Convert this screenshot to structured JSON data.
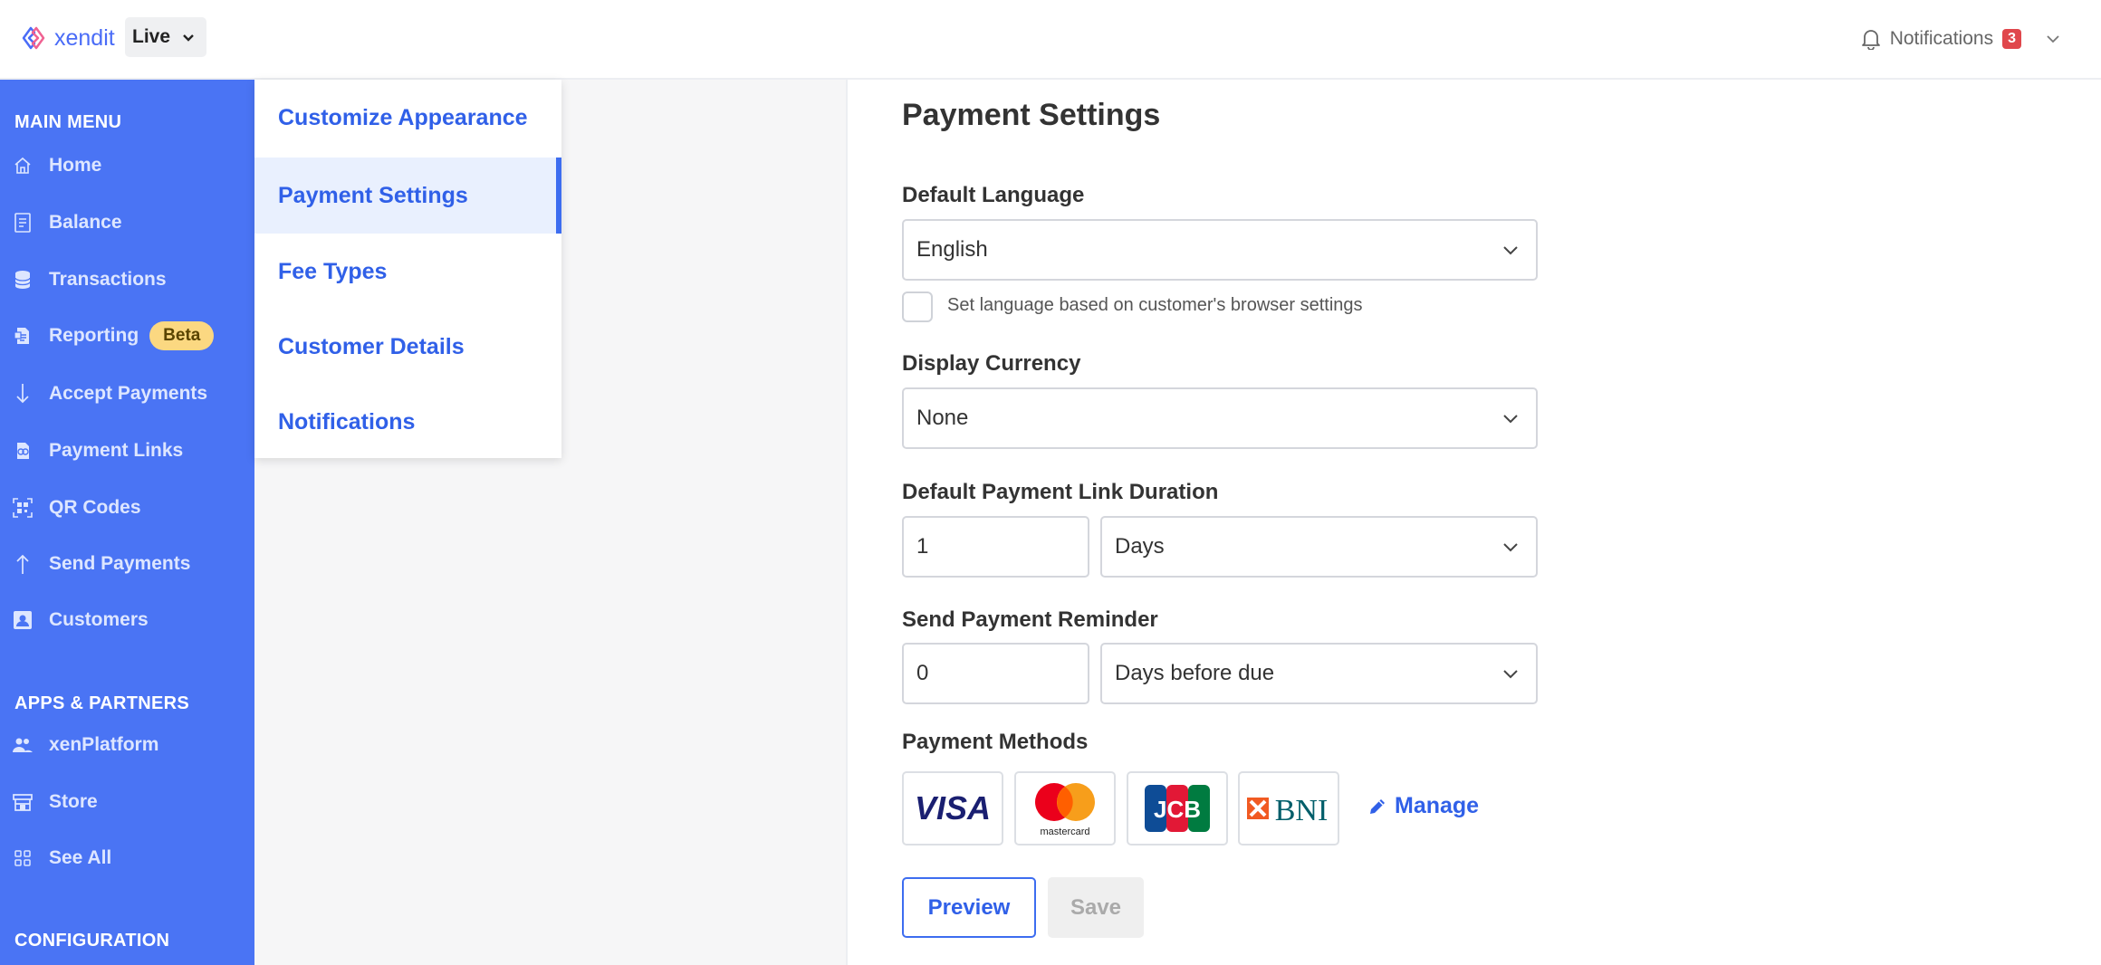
{
  "topbar": {
    "brand": "xendit",
    "environment": "Live",
    "notifications_label": "Notifications",
    "notifications_count": "3"
  },
  "sidebar": {
    "main_menu_title": "MAIN MENU",
    "main_items": [
      {
        "label": "Home",
        "icon": "home-icon"
      },
      {
        "label": "Balance",
        "icon": "document-icon"
      },
      {
        "label": "Transactions",
        "icon": "coins-icon"
      },
      {
        "label": "Reporting",
        "icon": "report-icon",
        "badge": "Beta"
      },
      {
        "label": "Accept Payments",
        "icon": "arrow-down-icon"
      },
      {
        "label": "Payment Links",
        "icon": "link-icon"
      },
      {
        "label": "QR Codes",
        "icon": "qr-code-icon"
      },
      {
        "label": "Send Payments",
        "icon": "arrow-up-icon"
      },
      {
        "label": "Customers",
        "icon": "user-card-icon"
      }
    ],
    "apps_title": "APPS & PARTNERS",
    "apps_items": [
      {
        "label": "xenPlatform",
        "icon": "users-icon"
      },
      {
        "label": "Store",
        "icon": "store-icon"
      },
      {
        "label": "See All",
        "icon": "grid-icon"
      }
    ],
    "config_title": "CONFIGURATION"
  },
  "subnav": {
    "items": [
      {
        "label": "Customize Appearance"
      },
      {
        "label": "Payment Settings"
      },
      {
        "label": "Fee Types"
      },
      {
        "label": "Customer Details"
      },
      {
        "label": "Notifications"
      }
    ],
    "active_index": 1
  },
  "form": {
    "title": "Payment Settings",
    "language": {
      "label": "Default Language",
      "value": "English"
    },
    "browser_language": {
      "label": "Set language based on customer's browser settings",
      "checked": false
    },
    "currency": {
      "label": "Display Currency",
      "value": "None"
    },
    "duration": {
      "label": "Default Payment Link Duration",
      "amount": "1",
      "unit": "Days"
    },
    "reminder": {
      "label": "Send Payment Reminder",
      "amount": "0",
      "unit": "Days before due"
    },
    "payment_methods": {
      "label": "Payment Methods",
      "cards": [
        {
          "name": "VISA",
          "logo_text": "VISA"
        },
        {
          "name": "Mastercard",
          "logo_text": "mastercard"
        },
        {
          "name": "JCB",
          "logo_text": "JCB"
        },
        {
          "name": "BNI",
          "logo_text": "BNI"
        }
      ],
      "manage_label": "Manage"
    },
    "preview_label": "Preview",
    "save_label": "Save"
  },
  "colors": {
    "sidebar_bg": "#4a74f4",
    "accent": "#3060e8",
    "badge_beta": "#fbd881",
    "notif_badge": "#e0474c"
  }
}
